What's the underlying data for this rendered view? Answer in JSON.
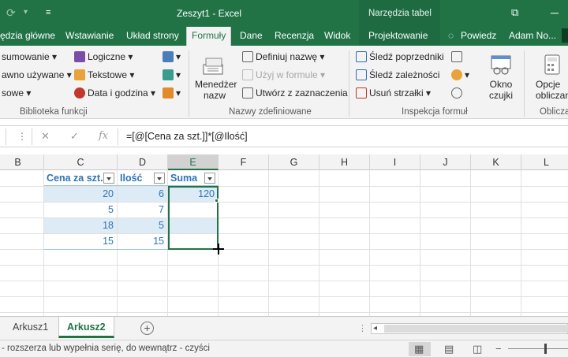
{
  "window": {
    "title": "Zeszyt1 - Excel",
    "context_tab_header": "Narzędzia tabel"
  },
  "tabs": [
    {
      "label": "ędzia główne"
    },
    {
      "label": "Wstawianie"
    },
    {
      "label": "Układ strony"
    },
    {
      "label": "Formuły",
      "active": true
    },
    {
      "label": "Dane"
    },
    {
      "label": "Recenzja"
    },
    {
      "label": "Widok"
    },
    {
      "label": "Projektowanie"
    },
    {
      "label": "Powiedz"
    },
    {
      "label": "Adam No..."
    }
  ],
  "ribbon": {
    "function_library": {
      "autosum": "sumowanie",
      "recently_used": "awno używane",
      "financial": "sowe",
      "logical": "Logiczne",
      "text": "Tekstowe",
      "date_time": "Data i godzina",
      "label": "Biblioteka funkcji"
    },
    "defined_names": {
      "name_manager": "Menedżer nazw",
      "name_manager_line1": "Menedżer",
      "name_manager_line2": "nazw",
      "define_name": "Definiuj nazwę",
      "use_in_formula": "Użyj w formule",
      "create_from_selection": "Utwórz z zaznaczenia",
      "label": "Nazwy zdefiniowane"
    },
    "formula_auditing": {
      "trace_precedents": "Śledź poprzedniki",
      "trace_dependents": "Śledź zależności",
      "remove_arrows": "Usuń strzałki",
      "label": "Inspekcja formuł"
    },
    "watch_window": {
      "line1": "Okno",
      "line2": "czujki"
    },
    "calc_options": {
      "line1": "Opcje",
      "line2": "obliczania"
    },
    "calculation_label": "Oblicza"
  },
  "formula_bar": {
    "cancel": "✕",
    "enter": "✓",
    "fx": "fx",
    "formula": "=[@[Cena za szt.]]*[@Ilość]"
  },
  "columns": [
    "B",
    "C",
    "D",
    "E",
    "F",
    "G",
    "H",
    "I",
    "J",
    "K",
    "L"
  ],
  "table": {
    "headers": [
      "Cena za szt.",
      "Ilość",
      "Suma"
    ],
    "rows": [
      [
        "20",
        "6",
        "120"
      ],
      [
        "5",
        "7",
        ""
      ],
      [
        "18",
        "5",
        ""
      ],
      [
        "15",
        "15",
        ""
      ]
    ]
  },
  "sheets": [
    {
      "label": "Arkusz1",
      "active": false
    },
    {
      "label": "Arkusz2",
      "active": true
    }
  ],
  "status_bar": {
    "message": "- rozszerza lub wypełnia serię, do wewnątrz - czyści"
  },
  "colors": {
    "excel_green": "#217346",
    "table_text": "#2e74b5",
    "band_fill": "#ddebf7"
  }
}
